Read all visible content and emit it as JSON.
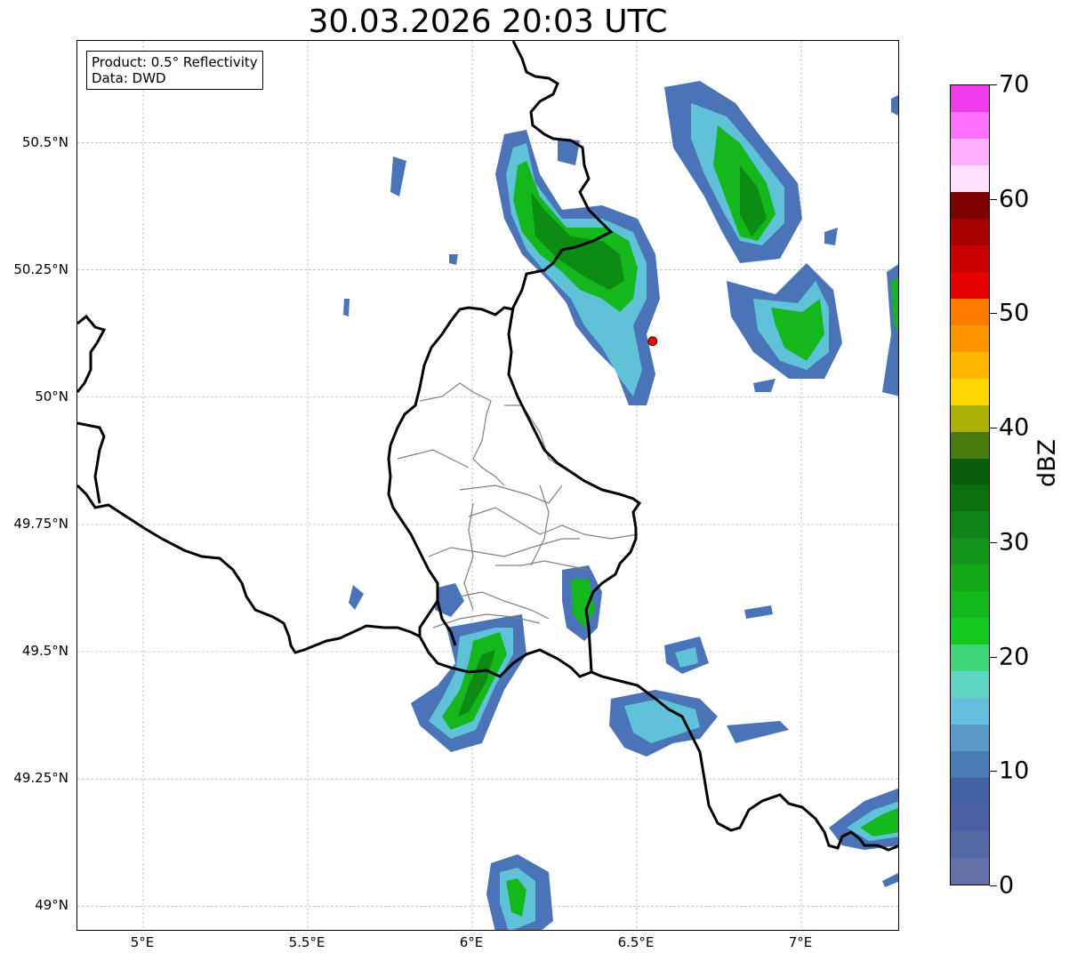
{
  "title": "30.03.2026 20:03 UTC",
  "info_box": {
    "product_line": "Product: 0.5° Reflectivity",
    "data_line": "Data: DWD"
  },
  "map": {
    "lon_range": [
      4.8,
      7.3
    ],
    "lat_range": [
      48.95,
      50.7
    ],
    "lat_ticks": [
      {
        "value": 50.5,
        "label": "50.5°N"
      },
      {
        "value": 50.25,
        "label": "50.25°N"
      },
      {
        "value": 50.0,
        "label": "50°N"
      },
      {
        "value": 49.75,
        "label": "49.75°N"
      },
      {
        "value": 49.5,
        "label": "49.5°N"
      },
      {
        "value": 49.25,
        "label": "49.25°N"
      },
      {
        "value": 49.0,
        "label": "49°N"
      }
    ],
    "lon_ticks": [
      {
        "value": 5.0,
        "label": "5°E"
      },
      {
        "value": 5.5,
        "label": "5.5°E"
      },
      {
        "value": 6.0,
        "label": "6°E"
      },
      {
        "value": 6.5,
        "label": "6.5°E"
      },
      {
        "value": 7.0,
        "label": "7°E"
      }
    ],
    "radar_site": {
      "lon": 6.548,
      "lat": 50.11,
      "color": "#ff0000"
    },
    "border_color": "#000000",
    "canton_color": "#808080",
    "grid": true
  },
  "colorbar": {
    "unit": "dBZ",
    "min": 0,
    "max": 70,
    "tick_labels": [
      "0",
      "10",
      "20",
      "30",
      "40",
      "50",
      "60",
      "70"
    ],
    "colors": [
      "#6471a6",
      "#5468a3",
      "#4a5fa4",
      "#4262a6",
      "#4a7bb4",
      "#5b9ac8",
      "#66bfdc",
      "#5fd6c3",
      "#3fd878",
      "#13c91d",
      "#13b91a",
      "#12a818",
      "#11961a",
      "#0f8418",
      "#0b7010",
      "#0a5e0b",
      "#487a0e",
      "#aab007",
      "#ffd600",
      "#ffb600",
      "#ff9600",
      "#ff7a00",
      "#e60000",
      "#c80000",
      "#a60000",
      "#7e0000",
      "#ffe0ff",
      "#ffb0ff",
      "#ff70ff",
      "#ee3cee"
    ]
  },
  "echo_colors": {
    "weak": "#4a73b8",
    "light": "#5fc2d8",
    "moderate": "#14b81d",
    "strong": "#0c8c12"
  }
}
